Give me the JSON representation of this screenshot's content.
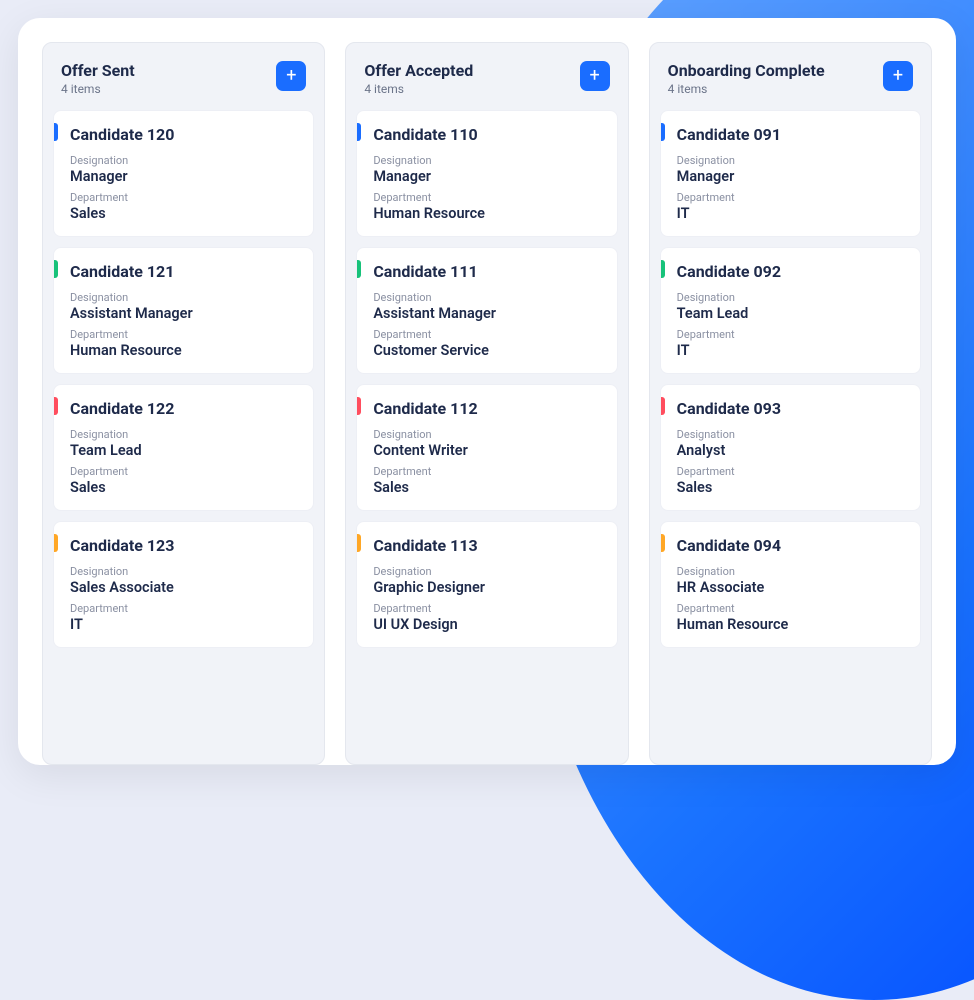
{
  "labels": {
    "designation": "Designation",
    "department": "Department",
    "add": "+"
  },
  "accentColors": [
    "blue",
    "green",
    "red",
    "orange"
  ],
  "columns": [
    {
      "title": "Offer Sent",
      "count": "4 items",
      "cards": [
        {
          "name": "Candidate 120",
          "designation": "Manager",
          "department": "Sales"
        },
        {
          "name": "Candidate 121",
          "designation": "Assistant Manager",
          "department": "Human Resource"
        },
        {
          "name": "Candidate 122",
          "designation": "Team Lead",
          "department": "Sales"
        },
        {
          "name": "Candidate 123",
          "designation": "Sales Associate",
          "department": "IT"
        }
      ]
    },
    {
      "title": "Offer Accepted",
      "count": "4 items",
      "cards": [
        {
          "name": "Candidate 110",
          "designation": "Manager",
          "department": "Human Resource"
        },
        {
          "name": "Candidate 111",
          "designation": "Assistant Manager",
          "department": "Customer Service"
        },
        {
          "name": "Candidate 112",
          "designation": "Content Writer",
          "department": "Sales"
        },
        {
          "name": "Candidate 113",
          "designation": "Graphic Designer",
          "department": "UI UX Design"
        }
      ]
    },
    {
      "title": "Onboarding Complete",
      "count": "4 items",
      "cards": [
        {
          "name": "Candidate 091",
          "designation": "Manager",
          "department": "IT"
        },
        {
          "name": "Candidate 092",
          "designation": "Team Lead",
          "department": "IT"
        },
        {
          "name": "Candidate 093",
          "designation": "Analyst",
          "department": "Sales"
        },
        {
          "name": "Candidate 094",
          "designation": "HR Associate",
          "department": "Human Resource"
        }
      ]
    }
  ]
}
